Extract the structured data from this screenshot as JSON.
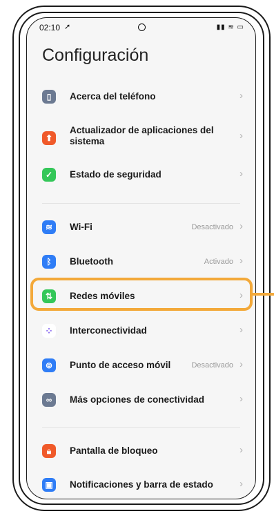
{
  "status_bar": {
    "time": "02:10",
    "signal": "▮▮ ≋ ▭"
  },
  "page_title": "Configuración",
  "rows": [
    {
      "id": "about",
      "label": "Acerca del teléfono",
      "icon": "phone-icon",
      "icon_color": "#6c7a92"
    },
    {
      "id": "updater",
      "label": "Actualizador de aplicaciones del sistema",
      "icon": "arrow-up-icon",
      "icon_color": "#f05a2a"
    },
    {
      "id": "security",
      "label": "Estado de seguridad",
      "icon": "shield-check-icon",
      "icon_color": "#34c759"
    },
    {
      "id": "wifi",
      "label": "Wi-Fi",
      "value": "Desactivado",
      "icon": "wifi-icon",
      "icon_color": "#2f7df6"
    },
    {
      "id": "bluetooth",
      "label": "Bluetooth",
      "value": "Activado",
      "icon": "bluetooth-icon",
      "icon_color": "#2f7df6"
    },
    {
      "id": "mobile",
      "label": "Redes móviles",
      "icon": "mobile-data-icon",
      "icon_color": "#34c759"
    },
    {
      "id": "interconnect",
      "label": "Interconectividad",
      "icon": "dots-icon",
      "icon_color": "#ffffff"
    },
    {
      "id": "hotspot",
      "label": "Punto de acceso móvil",
      "value": "Desactivado",
      "icon": "hotspot-icon",
      "icon_color": "#2f7df6"
    },
    {
      "id": "more-conn",
      "label": "Más opciones de conectividad",
      "icon": "link-icon",
      "icon_color": "#6c7a92"
    },
    {
      "id": "lock",
      "label": "Pantalla de bloqueo",
      "icon": "lock-icon",
      "icon_color": "#f05a2a"
    },
    {
      "id": "notifications",
      "label": "Notificaciones y barra de estado",
      "icon": "notification-icon",
      "icon_color": "#2f7df6"
    }
  ],
  "highlight_color": "#f3a93a"
}
